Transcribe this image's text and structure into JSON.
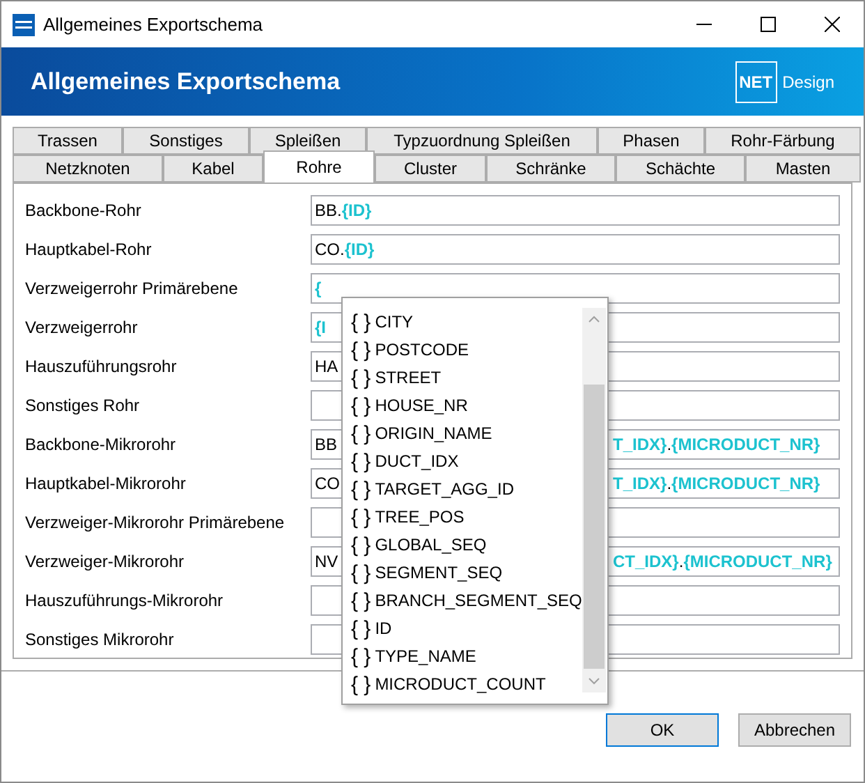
{
  "window": {
    "title": "Allgemeines Exportschema"
  },
  "header": {
    "title": "Allgemeines Exportschema",
    "logo": {
      "mark": "NET",
      "text": "Design"
    }
  },
  "tab_rows": [
    [
      {
        "label": "Trassen",
        "selected": false
      },
      {
        "label": "Sonstiges",
        "selected": false
      },
      {
        "label": "Spleißen",
        "selected": false
      },
      {
        "label": "Typzuordnung Spleißen",
        "selected": false
      },
      {
        "label": "Phasen",
        "selected": false
      },
      {
        "label": "Rohr-Färbung",
        "selected": false
      }
    ],
    [
      {
        "label": "Netzknoten",
        "selected": false
      },
      {
        "label": "Kabel",
        "selected": false
      },
      {
        "label": "Rohre",
        "selected": true
      },
      {
        "label": "Cluster",
        "selected": false
      },
      {
        "label": "Schränke",
        "selected": false
      },
      {
        "label": "Schächte",
        "selected": false
      },
      {
        "label": "Masten",
        "selected": false
      }
    ]
  ],
  "fields": [
    {
      "label": "Backbone-Rohr",
      "value": [
        {
          "kind": "text",
          "text": "BB."
        },
        {
          "kind": "token",
          "text": "{ID}"
        }
      ]
    },
    {
      "label": "Hauptkabel-Rohr",
      "value": [
        {
          "kind": "text",
          "text": "CO."
        },
        {
          "kind": "token",
          "text": "{ID}"
        }
      ]
    },
    {
      "label": "Verzweigerrohr Primärebene",
      "value": [
        {
          "kind": "token",
          "text": "{"
        }
      ]
    },
    {
      "label": "Verzweigerrohr",
      "value": [
        {
          "kind": "token",
          "text": "{I"
        }
      ]
    },
    {
      "label": "Hauszuführungsrohr",
      "value": [
        {
          "kind": "text",
          "text": "HA"
        }
      ]
    },
    {
      "label": "Sonstiges Rohr"
    },
    {
      "label": "Backbone-Mikrorohr",
      "value": [
        {
          "kind": "text",
          "text": "BB"
        }
      ],
      "value_tail": [
        {
          "kind": "token",
          "text": "T_IDX}"
        },
        {
          "kind": "text",
          "text": "."
        },
        {
          "kind": "token",
          "text": "{MICRODUCT_NR}"
        }
      ]
    },
    {
      "label": "Hauptkabel-Mikrorohr",
      "value": [
        {
          "kind": "text",
          "text": "CO"
        }
      ],
      "value_tail": [
        {
          "kind": "token",
          "text": "T_IDX}"
        },
        {
          "kind": "text",
          "text": "."
        },
        {
          "kind": "token",
          "text": "{MICRODUCT_NR}"
        }
      ]
    },
    {
      "label": "Verzweiger-Mikrorohr Primärebene"
    },
    {
      "label": "Verzweiger-Mikrorohr",
      "value": [
        {
          "kind": "text",
          "text": "NV"
        }
      ],
      "value_tail": [
        {
          "kind": "token",
          "text": "CT_IDX}"
        },
        {
          "kind": "text",
          "text": "."
        },
        {
          "kind": "token",
          "text": "{MICRODUCT_NR}"
        }
      ]
    },
    {
      "label": "Hauszuführungs-Mikrorohr"
    },
    {
      "label": "Sonstiges Mikrorohr"
    }
  ],
  "autocomplete": {
    "items": [
      {
        "icon": "{ }",
        "label": "CITY"
      },
      {
        "icon": "{ }",
        "label": "POSTCODE"
      },
      {
        "icon": "{ }",
        "label": "STREET"
      },
      {
        "icon": "{ }",
        "label": "HOUSE_NR"
      },
      {
        "icon": "{ }",
        "label": "ORIGIN_NAME"
      },
      {
        "icon": "{ }",
        "label": "DUCT_IDX"
      },
      {
        "icon": "{ }",
        "label": "TARGET_AGG_ID"
      },
      {
        "icon": "{ }",
        "label": "TREE_POS"
      },
      {
        "icon": "{ }",
        "label": "GLOBAL_SEQ"
      },
      {
        "icon": "{ }",
        "label": "SEGMENT_SEQ"
      },
      {
        "icon": "{ }",
        "label": "BRANCH_SEGMENT_SEQ"
      },
      {
        "icon": "{ }",
        "label": "ID"
      },
      {
        "icon": "{ }",
        "label": "TYPE_NAME"
      },
      {
        "icon": "{ }",
        "label": "MICRODUCT_COUNT"
      }
    ]
  },
  "buttons": [
    {
      "label": "OK",
      "kind": "default"
    },
    {
      "label": "Abbrechen",
      "kind": "normal"
    }
  ]
}
